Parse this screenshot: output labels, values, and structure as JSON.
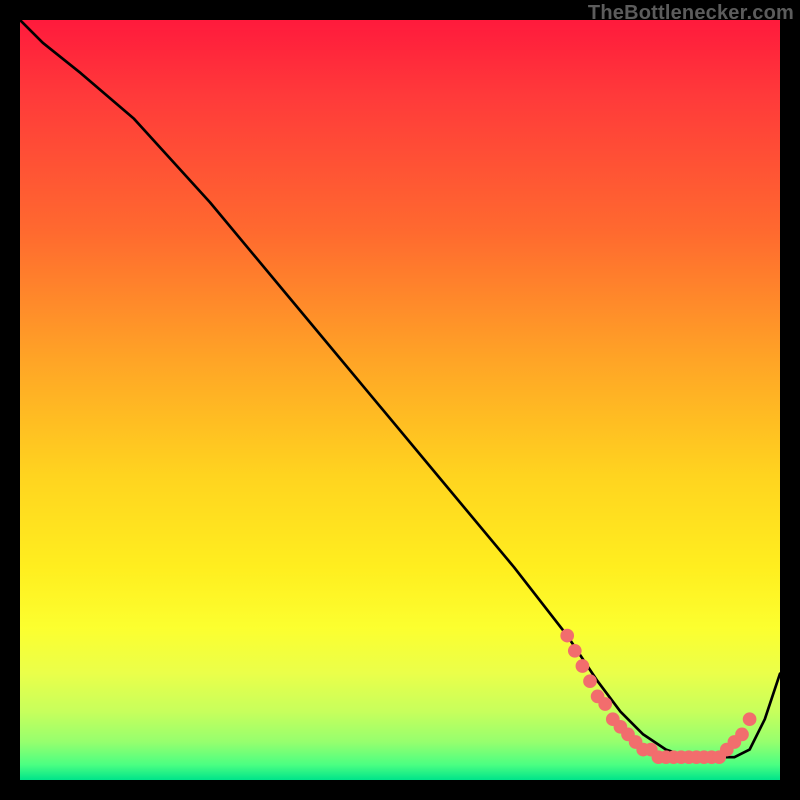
{
  "watermark": "TheBottlenecker.com",
  "colors": {
    "background": "#000000",
    "gradient_top": "#ff1a3c",
    "gradient_mid": "#ffee1f",
    "gradient_bottom": "#00e48a",
    "curve": "#000000",
    "marker": "#f26d6d"
  },
  "chart_data": {
    "type": "line",
    "title": "",
    "xlabel": "",
    "ylabel": "",
    "xlim": [
      0,
      100
    ],
    "ylim": [
      0,
      100
    ],
    "grid": false,
    "legend": null,
    "series": [
      {
        "name": "curve",
        "x": [
          0,
          3,
          8,
          15,
          25,
          35,
          45,
          55,
          65,
          72,
          76,
          79,
          82,
          85,
          88,
          90,
          92,
          94,
          96,
          98,
          100
        ],
        "y": [
          100,
          97,
          93,
          87,
          76,
          64,
          52,
          40,
          28,
          19,
          13,
          9,
          6,
          4,
          3,
          3,
          3,
          3,
          4,
          8,
          14
        ]
      }
    ],
    "markers": [
      {
        "x": 72,
        "y": 19
      },
      {
        "x": 73,
        "y": 17
      },
      {
        "x": 74,
        "y": 15
      },
      {
        "x": 75,
        "y": 13
      },
      {
        "x": 76,
        "y": 11
      },
      {
        "x": 77,
        "y": 10
      },
      {
        "x": 78,
        "y": 8
      },
      {
        "x": 79,
        "y": 7
      },
      {
        "x": 80,
        "y": 6
      },
      {
        "x": 81,
        "y": 5
      },
      {
        "x": 82,
        "y": 4
      },
      {
        "x": 83,
        "y": 4
      },
      {
        "x": 84,
        "y": 3
      },
      {
        "x": 85,
        "y": 3
      },
      {
        "x": 86,
        "y": 3
      },
      {
        "x": 87,
        "y": 3
      },
      {
        "x": 88,
        "y": 3
      },
      {
        "x": 89,
        "y": 3
      },
      {
        "x": 90,
        "y": 3
      },
      {
        "x": 91,
        "y": 3
      },
      {
        "x": 92,
        "y": 3
      },
      {
        "x": 93,
        "y": 4
      },
      {
        "x": 94,
        "y": 5
      },
      {
        "x": 95,
        "y": 6
      },
      {
        "x": 96,
        "y": 8
      }
    ]
  }
}
